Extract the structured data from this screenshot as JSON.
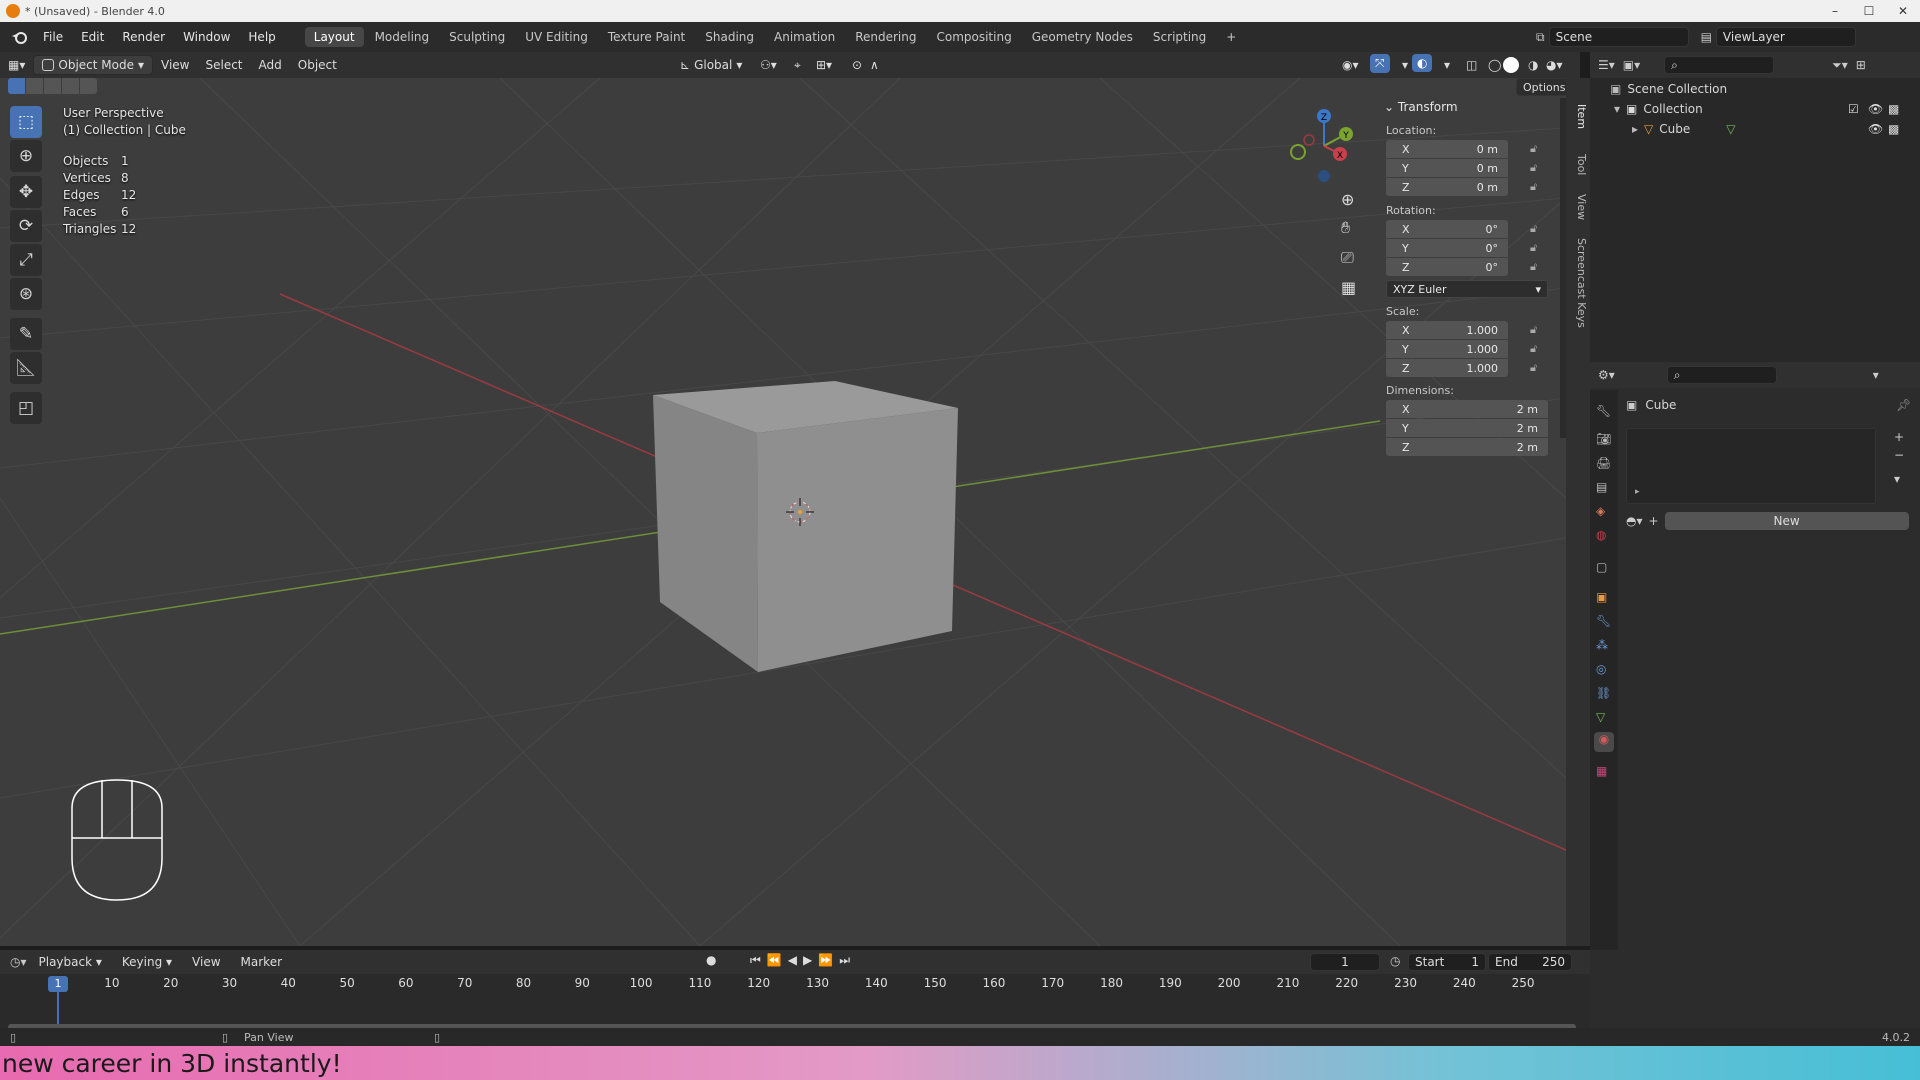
{
  "window": {
    "title": "* (Unsaved) - Blender 4.0",
    "controls": [
      "–",
      "☐",
      "✕"
    ]
  },
  "menu": [
    "File",
    "Edit",
    "Render",
    "Window",
    "Help"
  ],
  "workspaces": [
    "Layout",
    "Modeling",
    "Sculpting",
    "UV Editing",
    "Texture Paint",
    "Shading",
    "Animation",
    "Rendering",
    "Compositing",
    "Geometry Nodes",
    "Scripting"
  ],
  "active_workspace": "Layout",
  "scene": {
    "name": "Scene",
    "view_layer": "ViewLayer"
  },
  "viewport_header": {
    "mode": "Object Mode",
    "menus": [
      "View",
      "Select",
      "Add",
      "Object"
    ],
    "transform_orientation": "Global",
    "options_label": "Options"
  },
  "viewport_overlay": {
    "perspective": "User Perspective",
    "collection": "(1) Collection | Cube",
    "stats": [
      {
        "label": "Objects",
        "value": "1"
      },
      {
        "label": "Vertices",
        "value": "8"
      },
      {
        "label": "Edges",
        "value": "12"
      },
      {
        "label": "Faces",
        "value": "6"
      },
      {
        "label": "Triangles",
        "value": "12"
      }
    ]
  },
  "n_panel": {
    "header": "Transform",
    "location_label": "Location:",
    "location": [
      {
        "axis": "X",
        "value": "0 m"
      },
      {
        "axis": "Y",
        "value": "0 m"
      },
      {
        "axis": "Z",
        "value": "0 m"
      }
    ],
    "rotation_label": "Rotation:",
    "rotation": [
      {
        "axis": "X",
        "value": "0°"
      },
      {
        "axis": "Y",
        "value": "0°"
      },
      {
        "axis": "Z",
        "value": "0°"
      }
    ],
    "rotation_mode": "XYZ Euler",
    "scale_label": "Scale:",
    "scale": [
      {
        "axis": "X",
        "value": "1.000"
      },
      {
        "axis": "Y",
        "value": "1.000"
      },
      {
        "axis": "Z",
        "value": "1.000"
      }
    ],
    "dimensions_label": "Dimensions:",
    "dimensions": [
      {
        "axis": "X",
        "value": "2 m"
      },
      {
        "axis": "Y",
        "value": "2 m"
      },
      {
        "axis": "Z",
        "value": "2 m"
      }
    ],
    "side_tabs": [
      "Item",
      "Tool",
      "View",
      "Screencast Keys"
    ]
  },
  "gizmo_axes": {
    "x": "X",
    "y": "Y",
    "z": "Z"
  },
  "outliner": {
    "root": "Scene Collection",
    "collection": "Collection",
    "object": "Cube"
  },
  "properties": {
    "object_name": "Cube",
    "new_button": "New"
  },
  "timeline": {
    "menus": [
      "Playback",
      "Keying",
      "View",
      "Marker"
    ],
    "current_frame": "1",
    "start_label": "Start",
    "start": "1",
    "end_label": "End",
    "end": "250",
    "ticks": [
      "1",
      "10",
      "20",
      "30",
      "40",
      "50",
      "60",
      "70",
      "80",
      "90",
      "100",
      "110",
      "120",
      "130",
      "140",
      "150",
      "160",
      "170",
      "180",
      "190",
      "200",
      "210",
      "220",
      "230",
      "240",
      "250"
    ]
  },
  "statusbar": {
    "hint": "Pan View",
    "version": "4.0.2"
  },
  "banner": {
    "text": "new career in 3D instantly!"
  },
  "colors": {
    "accent": "#4772b3",
    "x_axis": "#c7404b",
    "y_axis": "#7aa32f",
    "z_axis": "#3d78c7"
  }
}
